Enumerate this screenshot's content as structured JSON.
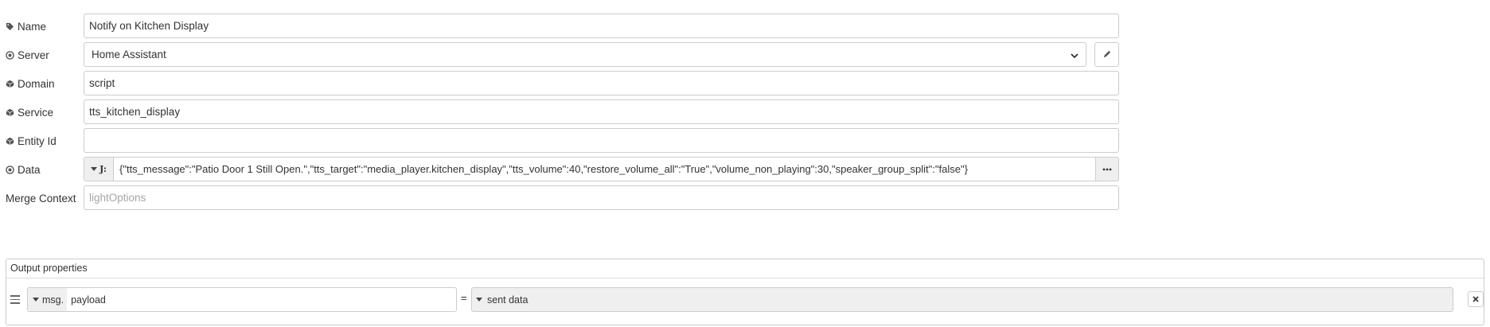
{
  "fields": {
    "name": {
      "label": "Name",
      "icon": "tag-icon",
      "value": "Notify on Kitchen Display"
    },
    "server": {
      "label": "Server",
      "icon": "dot-circle-icon",
      "value": "Home Assistant"
    },
    "domain": {
      "label": "Domain",
      "icon": "cube-icon",
      "value": "script"
    },
    "service": {
      "label": "Service",
      "icon": "cube-icon",
      "value": "tts_kitchen_display"
    },
    "entity_id": {
      "label": "Entity Id",
      "icon": "cube-icon",
      "value": ""
    },
    "data": {
      "label": "Data",
      "icon": "dot-circle-icon",
      "type_symbol": "J:",
      "value": "{\"tts_message\":\"Patio Door 1 Still Open.\",\"tts_target\":\"media_player.kitchen_display\",\"tts_volume\":40,\"restore_volume_all\":\"True\",\"volume_non_playing\":30,\"speaker_group_split\":\"false\"}"
    },
    "merge_context": {
      "label": "Merge Context",
      "placeholder": "lightOptions",
      "value": ""
    }
  },
  "output": {
    "title": "Output properties",
    "rows": [
      {
        "type_label": "msg.",
        "property": "payload",
        "equals": "=",
        "value": "sent data"
      }
    ]
  },
  "icons": [
    "tag-icon",
    "dot-circle-icon",
    "cube-icon",
    "chevron-down-icon",
    "pencil-icon",
    "ellipsis-icon",
    "drag-handle-icon",
    "close-icon"
  ]
}
